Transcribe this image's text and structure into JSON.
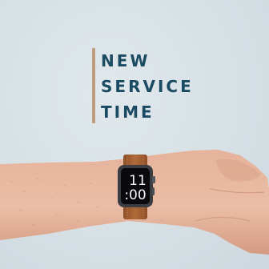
{
  "headline": {
    "line1": "NEW",
    "line2": "SERVICE",
    "line3": "TIME"
  },
  "watch": {
    "hour": "11",
    "minute": ":00"
  },
  "colors": {
    "background": "#d6e0e5",
    "headline": "#1b4a63",
    "accent_bar": "#bf9e80",
    "strap": "#a35f30",
    "watch_case": "#3a3d42",
    "skin": "#e6b29a"
  }
}
